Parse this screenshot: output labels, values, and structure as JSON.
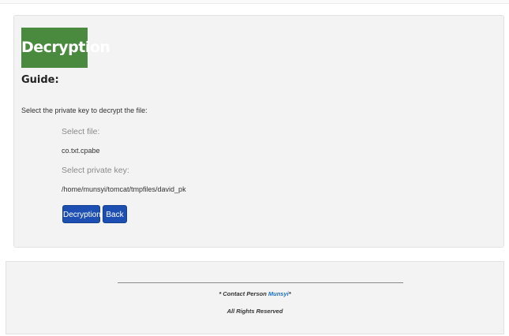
{
  "page": {
    "title": "Decryption",
    "guide_label": "Guide:",
    "instruction": "Select the private key to decrypt the file:"
  },
  "form": {
    "select_file_label": "Select file:",
    "select_file_value": "co.txt.cpabe",
    "select_key_label": "Select private key:",
    "select_key_value": "/home/munsyi/tomcat/tmpfiles/david_pk"
  },
  "buttons": {
    "decrypt_label": "Decryption",
    "back_label": "Back"
  },
  "footer": {
    "contact_prefix": "* Contact Person ",
    "contact_name": "Munsyi",
    "contact_suffix": "*",
    "rights": "All Rights Reserved"
  },
  "colors": {
    "title_bg": "#4a8a3f",
    "button_bg": "#1d4fb3",
    "link": "#1d6fc4"
  }
}
